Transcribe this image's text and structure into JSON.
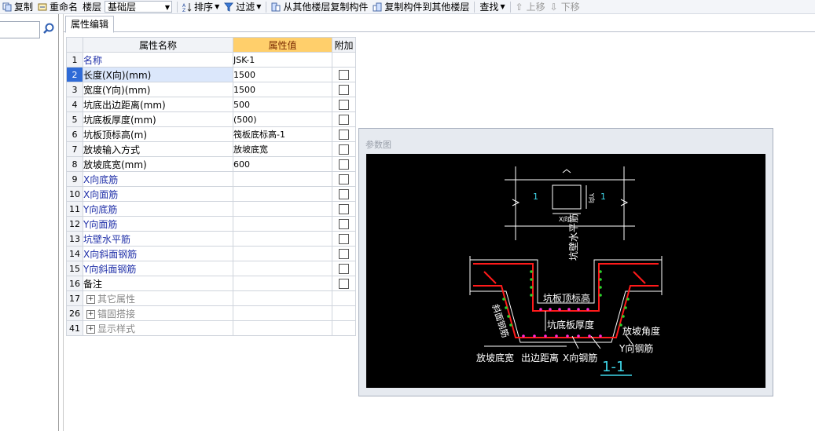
{
  "toolbar": {
    "copy": "复制",
    "rename": "重命名",
    "floor_label": "楼层",
    "floor_value": "基础层",
    "sort": "排序",
    "filter": "过滤",
    "copy_from_other": "从其他楼层复制构件",
    "copy_to_other": "复制构件到其他楼层",
    "find": "查找",
    "move_up": "上移",
    "move_down": "下移"
  },
  "tab": {
    "label": "属性编辑"
  },
  "grid": {
    "headers": {
      "name": "属性名称",
      "value": "属性值",
      "extra": "附加"
    },
    "rows": [
      {
        "no": "1",
        "name": "名称",
        "value": "JSK-1"
      },
      {
        "no": "2",
        "name": "长度(X向)(mm)",
        "value": "1500"
      },
      {
        "no": "3",
        "name": "宽度(Y向)(mm)",
        "value": "1500"
      },
      {
        "no": "4",
        "name": "坑底出边距离(mm)",
        "value": "500"
      },
      {
        "no": "5",
        "name": "坑底板厚度(mm)",
        "value": "(500)"
      },
      {
        "no": "6",
        "name": "坑板顶标高(m)",
        "value": "筏板底标高-1"
      },
      {
        "no": "7",
        "name": "放坡输入方式",
        "value": "放坡底宽"
      },
      {
        "no": "8",
        "name": "放坡底宽(mm)",
        "value": "600"
      },
      {
        "no": "9",
        "name": "X向底筋",
        "value": ""
      },
      {
        "no": "10",
        "name": "X向面筋",
        "value": ""
      },
      {
        "no": "11",
        "name": "Y向底筋",
        "value": ""
      },
      {
        "no": "12",
        "name": "Y向面筋",
        "value": ""
      },
      {
        "no": "13",
        "name": "坑壁水平筋",
        "value": ""
      },
      {
        "no": "14",
        "name": "X向斜面钢筋",
        "value": ""
      },
      {
        "no": "15",
        "name": "Y向斜面钢筋",
        "value": ""
      },
      {
        "no": "16",
        "name": "备注",
        "value": ""
      }
    ],
    "groups": [
      {
        "no": "17",
        "name": "其它属性"
      },
      {
        "no": "26",
        "name": "锚固搭接"
      },
      {
        "no": "41",
        "name": "显示样式"
      }
    ]
  },
  "panel": {
    "title": "参数图",
    "diagram": {
      "label_1": "1",
      "label_y": "Y向",
      "label_x": "X向",
      "wall_bar": "坑壁水平筋",
      "top_elev": "坑板顶标高",
      "slope_bar": "斜面钢筋",
      "bottom_thk": "坑底板厚度",
      "slope_angle": "放坡角度",
      "y_bar": "Y向钢筋",
      "slope_width": "放坡底宽",
      "edge_dist": "出边距离",
      "x_bar": "X向钢筋",
      "section": "1-1"
    }
  },
  "colors": {
    "selected_row": "#2f6bd7",
    "value_header": "#ffcf6b",
    "rebar_red": "#ff1a1a",
    "rebar_green": "#2bd12b",
    "rebar_magenta": "#ff2bd6",
    "cyan": "#3fd6e8"
  }
}
